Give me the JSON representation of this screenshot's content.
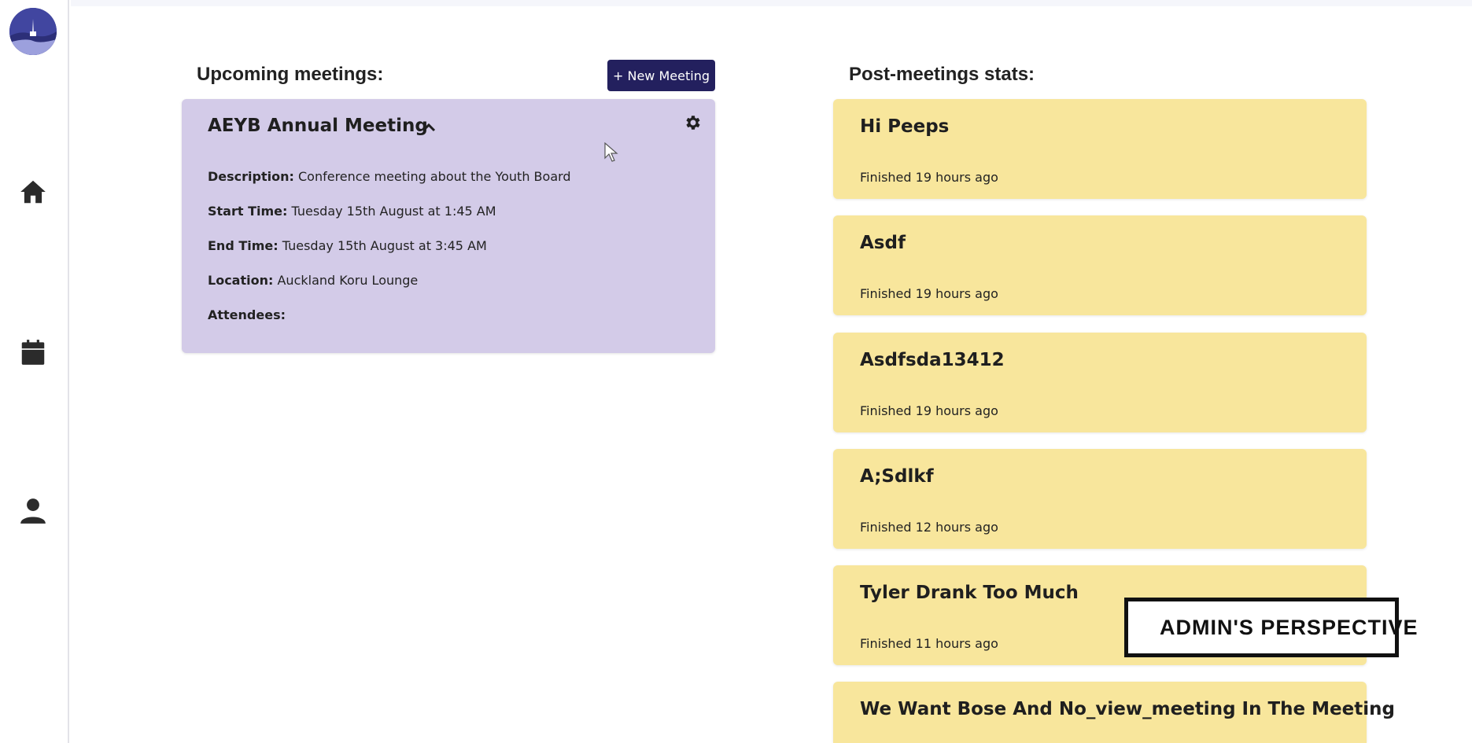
{
  "sidebar": {
    "logo": "app-logo",
    "items": [
      {
        "icon": "home-icon"
      },
      {
        "icon": "calendar-icon"
      },
      {
        "icon": "user-icon"
      }
    ]
  },
  "upcoming": {
    "title": "Upcoming meetings:",
    "new_meeting_label": "+ New Meeting",
    "meeting": {
      "title": "AEYB Annual Meeting",
      "description_label": "Description:",
      "description": "Conference meeting about the Youth Board",
      "start_label": "Start Time:",
      "start": "Tuesday 15th August at 1:45 AM",
      "end_label": "End Time:",
      "end": "Tuesday 15th August at 3:45 AM",
      "location_label": "Location:",
      "location": "Auckland Koru Lounge",
      "attendees_label": "Attendees:"
    }
  },
  "post": {
    "title": "Post-meetings stats:",
    "items": [
      {
        "title": "Hi Peeps",
        "status": "Finished 19 hours ago"
      },
      {
        "title": "Asdf",
        "status": "Finished 19 hours ago"
      },
      {
        "title": "Asdfsda13412",
        "status": "Finished 19 hours ago"
      },
      {
        "title": "A;Sdlkf",
        "status": "Finished 12 hours ago"
      },
      {
        "title": "Tyler Drank Too Much",
        "status": "Finished 11 hours ago"
      },
      {
        "title": "We Want Bose And No_view_meeting In The Meeting",
        "status": ""
      }
    ]
  },
  "watermark": {
    "label": "ADMIN'S PERSPECTIVE",
    "icon": "eye-icon"
  },
  "colors": {
    "accent": "#23205e",
    "meeting_card": "#d3cbe8",
    "stat_card": "#f8e69c"
  }
}
